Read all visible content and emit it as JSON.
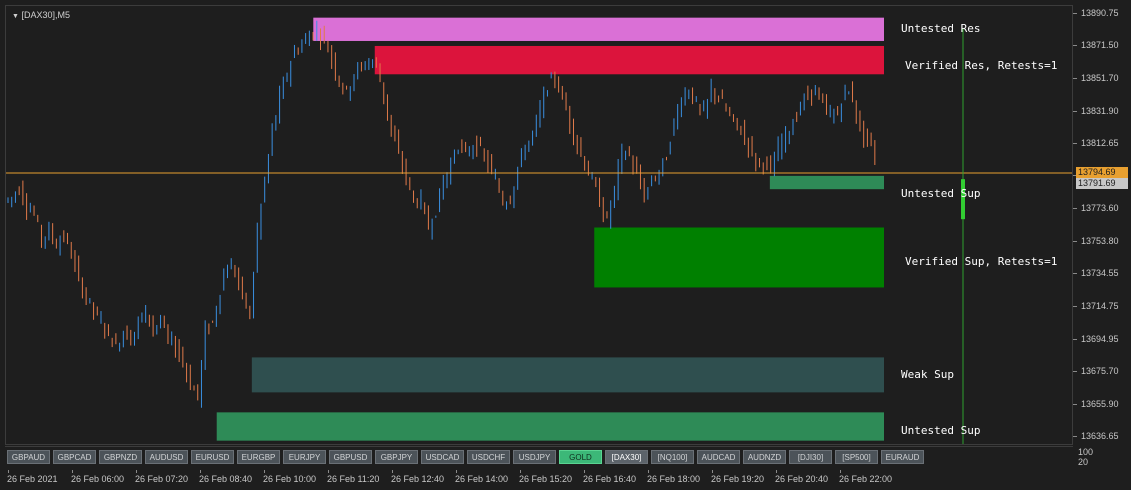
{
  "chart": {
    "title": "[DAX30],M5",
    "current_price": "13791.69",
    "ask_price": "13794.69",
    "price_min": 13632,
    "price_max": 13895
  },
  "colors": {
    "background": "#1e1e1e",
    "bull_candle": "#3a8fe0",
    "bear_candle": "#e07a4a",
    "price_line": "#e8a030",
    "vline": "#2fa02f"
  },
  "price_axis": {
    "labels": [
      "13890.75",
      "13871.50",
      "13851.70",
      "13831.90",
      "13812.65",
      "13793.60",
      "13773.60",
      "13753.80",
      "13734.55",
      "13714.75",
      "13694.95",
      "13675.70",
      "13655.90",
      "13636.65"
    ]
  },
  "time_axis": {
    "labels": [
      "26 Feb 2021",
      "26 Feb 06:00",
      "26 Feb 07:20",
      "26 Feb 08:40",
      "26 Feb 10:00",
      "26 Feb 11:20",
      "26 Feb 12:40",
      "26 Feb 14:00",
      "26 Feb 15:20",
      "26 Feb 16:40",
      "26 Feb 18:00",
      "26 Feb 19:20",
      "26 Feb 20:40",
      "26 Feb 22:00"
    ]
  },
  "zones": [
    {
      "label": "Untested Res",
      "top": 13888,
      "bottom": 13874,
      "start": 0.35,
      "color": "#da70d6"
    },
    {
      "label": "Verified Res, Retests=1",
      "top": 13871,
      "bottom": 13854,
      "start": 0.42,
      "color": "#dc143c"
    },
    {
      "label": "Untested Sup",
      "top": 13793,
      "bottom": 13785,
      "start": 0.87,
      "color": "#2e8b57"
    },
    {
      "label": "Verified Sup, Retests=1",
      "top": 13762,
      "bottom": 13726,
      "start": 0.67,
      "color": "#008000"
    },
    {
      "label": "Weak Sup",
      "top": 13684,
      "bottom": 13663,
      "start": 0.28,
      "color": "#2f4f4f"
    },
    {
      "label": "Untested Sup",
      "top": 13651,
      "bottom": 13634,
      "start": 0.24,
      "color": "#2e8b57"
    }
  ],
  "symbol_bar": {
    "buttons": [
      "GBPAUD",
      "GBPCAD",
      "GBPNZD",
      "AUDUSD",
      "EURUSD",
      "EURGBP",
      "EURJPY",
      "GBPUSD",
      "GBPJPY",
      "USDCAD",
      "USDCHF",
      "USDJPY",
      "GOLD",
      "[DAX30]",
      "[NQ100]",
      "AUDCAD",
      "AUDNZD",
      "[DJI30]",
      "[SP500]",
      "EURAUD"
    ],
    "active": "GOLD",
    "current": "[DAX30]"
  },
  "indicator": {
    "scale_max": "100",
    "scale_min": "20"
  },
  "chart_data": {
    "type": "candlestick",
    "title": "[DAX30],M5",
    "x_labels": [
      "26 Feb 2021",
      "26 Feb 06:00",
      "26 Feb 07:20",
      "26 Feb 08:40",
      "26 Feb 10:00",
      "26 Feb 11:20",
      "26 Feb 12:40",
      "26 Feb 14:00",
      "26 Feb 15:20",
      "26 Feb 16:40",
      "26 Feb 18:00",
      "26 Feb 19:20",
      "26 Feb 20:40",
      "26 Feb 22:00"
    ],
    "ylim": [
      13632,
      13895
    ],
    "path_close": [
      13778,
      13780,
      13786,
      13775,
      13770,
      13755,
      13760,
      13752,
      13757,
      13746,
      13730,
      13720,
      13712,
      13705,
      13698,
      13690,
      13700,
      13695,
      13705,
      13712,
      13702,
      13705,
      13695,
      13690,
      13682,
      13668,
      13660,
      13700,
      13705,
      13725,
      13740,
      13735,
      13720,
      13710,
      13760,
      13790,
      13820,
      13840,
      13855,
      13868,
      13872,
      13878,
      13880,
      13875,
      13863,
      13850,
      13843,
      13855,
      13858,
      13862,
      13860,
      13840,
      13820,
      13805,
      13792,
      13778,
      13778,
      13762,
      13773,
      13790,
      13800,
      13812,
      13805,
      13812,
      13808,
      13800,
      13790,
      13778,
      13780,
      13798,
      13810,
      13818,
      13832,
      13848,
      13852,
      13840,
      13825,
      13812,
      13800,
      13790,
      13778,
      13765,
      13785,
      13808,
      13805,
      13793,
      13781,
      13790,
      13795,
      13805,
      13825,
      13840,
      13845,
      13835,
      13830,
      13845,
      13840,
      13832,
      13825,
      13820,
      13812,
      13800,
      13802,
      13795,
      13810,
      13818,
      13825,
      13835,
      13842,
      13845,
      13835,
      13830,
      13830,
      13845,
      13840,
      13820,
      13815,
      13805
    ]
  }
}
